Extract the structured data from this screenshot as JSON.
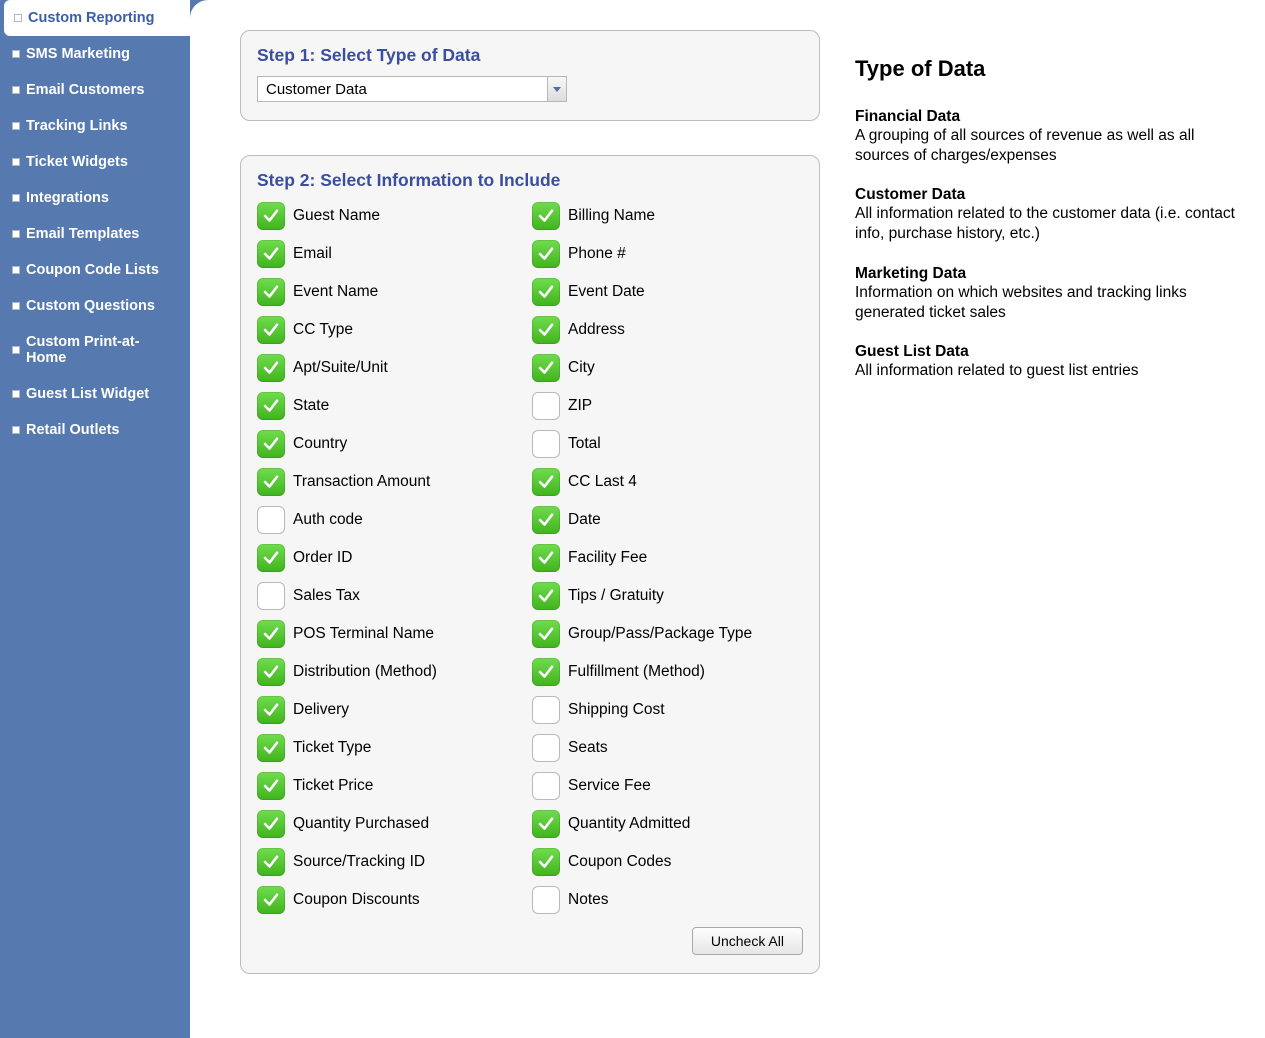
{
  "sidebar": {
    "items": [
      {
        "label": "Custom Reporting",
        "active": true
      },
      {
        "label": "SMS Marketing",
        "active": false
      },
      {
        "label": "Email Customers",
        "active": false
      },
      {
        "label": "Tracking Links",
        "active": false
      },
      {
        "label": "Ticket Widgets",
        "active": false
      },
      {
        "label": "Integrations",
        "active": false
      },
      {
        "label": "Email Templates",
        "active": false
      },
      {
        "label": "Coupon Code Lists",
        "active": false
      },
      {
        "label": "Custom Questions",
        "active": false
      },
      {
        "label": "Custom Print-at-Home",
        "active": false
      },
      {
        "label": "Guest List Widget",
        "active": false
      },
      {
        "label": "Retail Outlets",
        "active": false
      }
    ]
  },
  "step1": {
    "title": "Step 1: Select Type of Data",
    "selected": "Customer Data"
  },
  "step2": {
    "title": "Step 2: Select Information to Include",
    "uncheck_label": "Uncheck All",
    "options": [
      {
        "label": "Guest Name",
        "checked": true
      },
      {
        "label": "Billing Name",
        "checked": true
      },
      {
        "label": "Email",
        "checked": true
      },
      {
        "label": "Phone #",
        "checked": true
      },
      {
        "label": "Event Name",
        "checked": true
      },
      {
        "label": "Event Date",
        "checked": true
      },
      {
        "label": "CC Type",
        "checked": true
      },
      {
        "label": "Address",
        "checked": true
      },
      {
        "label": "Apt/Suite/Unit",
        "checked": true
      },
      {
        "label": "City",
        "checked": true
      },
      {
        "label": "State",
        "checked": true
      },
      {
        "label": "ZIP",
        "checked": false
      },
      {
        "label": "Country",
        "checked": true
      },
      {
        "label": "Total",
        "checked": false
      },
      {
        "label": "Transaction Amount",
        "checked": true
      },
      {
        "label": "CC Last 4",
        "checked": true
      },
      {
        "label": "Auth code",
        "checked": false
      },
      {
        "label": "Date",
        "checked": true
      },
      {
        "label": "Order ID",
        "checked": true
      },
      {
        "label": "Facility Fee",
        "checked": true
      },
      {
        "label": "Sales Tax",
        "checked": false
      },
      {
        "label": "Tips / Gratuity",
        "checked": true
      },
      {
        "label": "POS Terminal Name",
        "checked": true
      },
      {
        "label": "Group/Pass/Package Type",
        "checked": true
      },
      {
        "label": "Distribution (Method)",
        "checked": true
      },
      {
        "label": "Fulfillment (Method)",
        "checked": true
      },
      {
        "label": "Delivery",
        "checked": true
      },
      {
        "label": "Shipping Cost",
        "checked": false
      },
      {
        "label": "Ticket Type",
        "checked": true
      },
      {
        "label": "Seats",
        "checked": false
      },
      {
        "label": "Ticket Price",
        "checked": true
      },
      {
        "label": "Service Fee",
        "checked": false
      },
      {
        "label": "Quantity Purchased",
        "checked": true
      },
      {
        "label": "Quantity Admitted",
        "checked": true
      },
      {
        "label": "Source/Tracking ID",
        "checked": true
      },
      {
        "label": "Coupon Codes",
        "checked": true
      },
      {
        "label": "Coupon Discounts",
        "checked": true
      },
      {
        "label": "Notes",
        "checked": false
      }
    ]
  },
  "info": {
    "title": "Type of Data",
    "blocks": [
      {
        "h": "Financial Data",
        "p": "A grouping of all sources of revenue as well as all sources of charges/expenses"
      },
      {
        "h": "Customer Data",
        "p": "All information related to the customer data (i.e. contact info, purchase history, etc.)"
      },
      {
        "h": "Marketing Data",
        "p": "Information on which websites and tracking links generated ticket sales"
      },
      {
        "h": "Guest List Data",
        "p": "All information related to guest list entries"
      }
    ]
  }
}
